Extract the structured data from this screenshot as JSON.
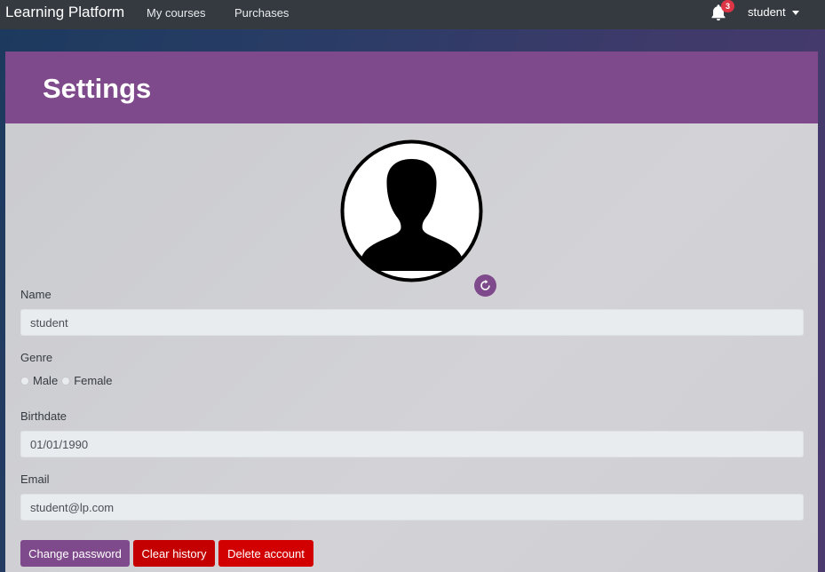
{
  "navbar": {
    "brand": "Learning Platform",
    "links": [
      "My courses",
      "Purchases"
    ],
    "notification_count": "3",
    "user": "student"
  },
  "settings": {
    "title": "Settings",
    "name_label": "Name",
    "name_value": "student",
    "genre_label": "Genre",
    "genre_options": [
      "Male",
      "Female"
    ],
    "birthdate_label": "Birthdate",
    "birthdate_value": "01/01/1990",
    "email_label": "Email",
    "email_value": "student@lp.com"
  },
  "actions": {
    "change_password": "Change password",
    "clear_history": "Clear history",
    "delete_account": "Delete account"
  },
  "colors": {
    "navbar": "#343a40",
    "accent": "#7f4a8c",
    "danger": "#c40000",
    "badge": "#dc3545"
  },
  "icons": {
    "notification": "bell-icon",
    "avatar": "user-silhouette-icon",
    "reset": "rotate-icon",
    "dropdown": "caret-down-icon"
  }
}
